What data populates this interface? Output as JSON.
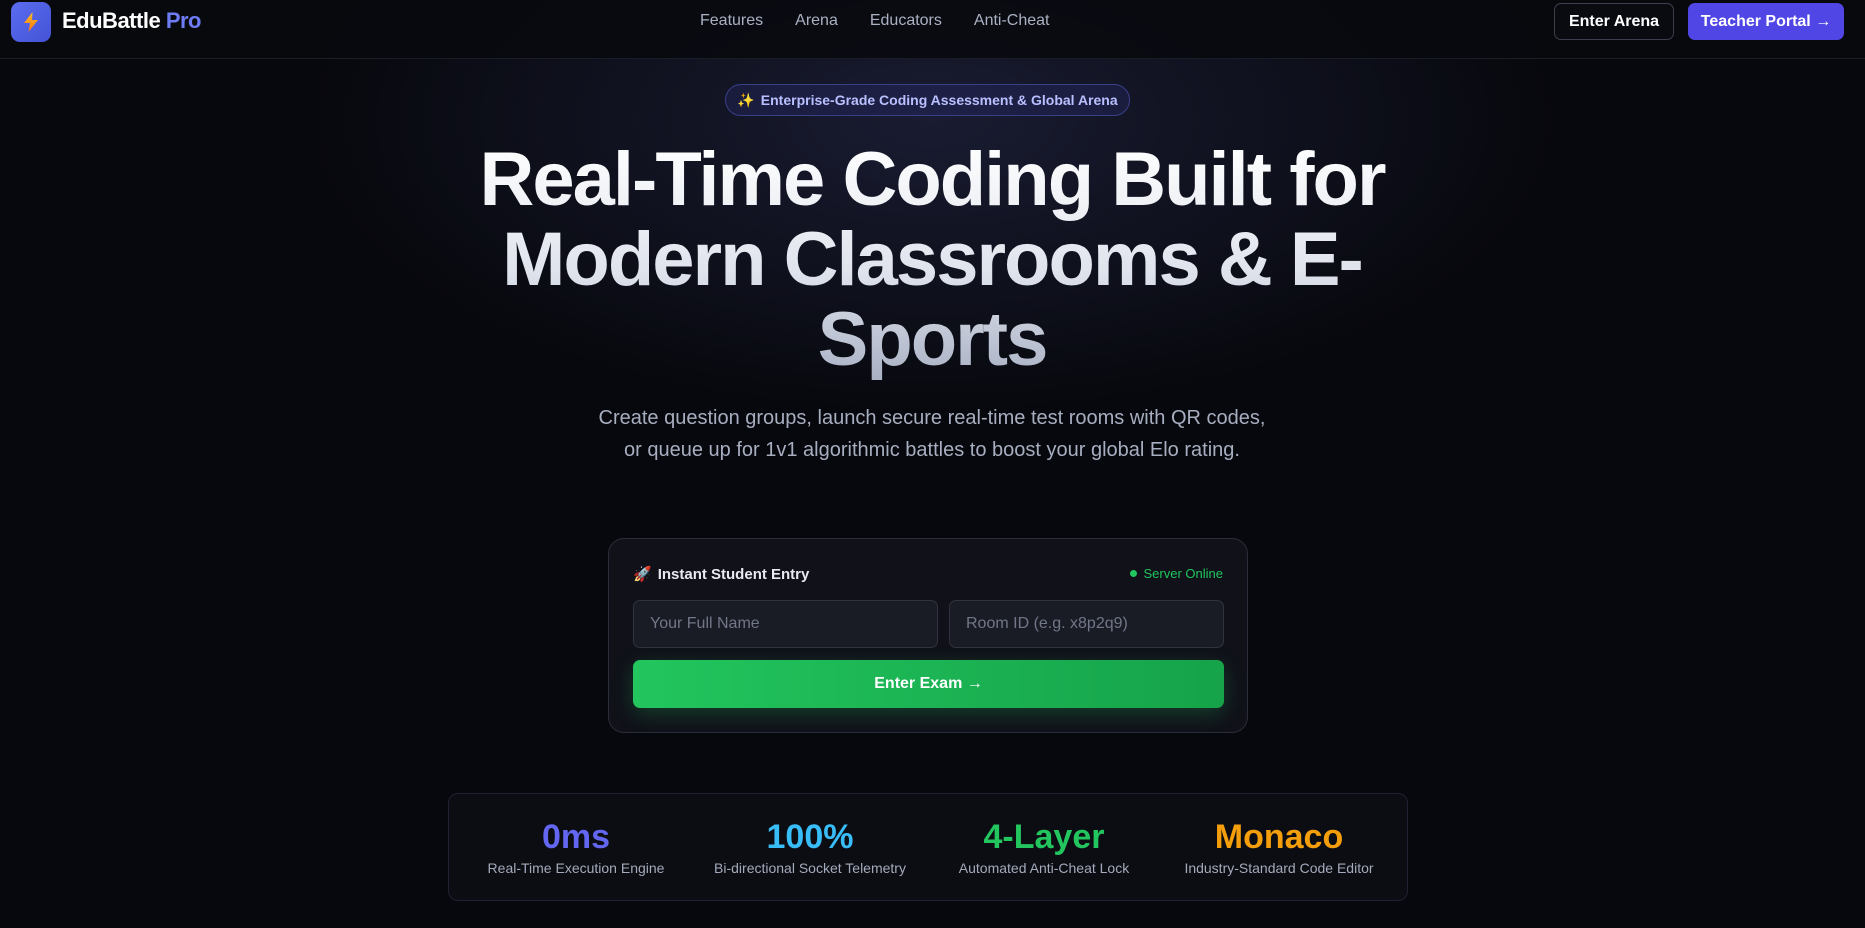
{
  "brand": {
    "name": "EduBattle",
    "suffix": "Pro",
    "icon": "lightning-bolt-icon"
  },
  "nav": {
    "links": [
      "Features",
      "Arena",
      "Educators",
      "Anti-Cheat"
    ],
    "enter_arena": "Enter Arena",
    "teacher_portal": "Teacher Portal →"
  },
  "hero": {
    "badge_icon": "✨",
    "badge_text": "Enterprise-Grade Coding Assessment & Global Arena",
    "headline_line1": "Real-Time Coding Built for",
    "headline_line2": "Modern Classrooms & E-",
    "headline_line3": "Sports",
    "subtitle": "Create question groups, launch secure real-time test rooms with QR codes, or queue up for 1v1 algorithmic battles to boost your global Elo rating."
  },
  "entry": {
    "icon": "🚀",
    "title": "Instant Student Entry",
    "status": "Server Online",
    "name_placeholder": "Your Full Name",
    "room_placeholder": "Room ID (e.g. x8p2q9)",
    "submit": "Enter Exam →"
  },
  "stats": [
    {
      "value": "0ms",
      "label": "Real-Time Execution Engine",
      "color": "#6366f1"
    },
    {
      "value": "100%",
      "label": "Bi-directional Socket Telemetry",
      "color": "#38bdf8"
    },
    {
      "value": "4-Layer",
      "label": "Automated Anti-Cheat Lock",
      "color": "#22c55e"
    },
    {
      "value": "Monaco",
      "label": "Industry-Standard Code Editor",
      "color": "#f59e0b"
    }
  ],
  "colors": {
    "accent": "#4f46e5",
    "success": "#22c55e",
    "background": "#07080d"
  }
}
